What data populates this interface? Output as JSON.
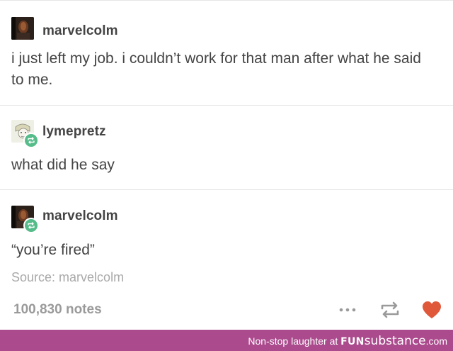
{
  "posts": [
    {
      "username": "marvelcolm",
      "text": "i just left my job. i couldn’t work for that man after what he said to me.",
      "avatar_icon": "dark-portrait-avatar",
      "reblog": false
    },
    {
      "username": "lymepretz",
      "text": "what did he say",
      "avatar_icon": "sketch-portrait-avatar",
      "reblog": true
    },
    {
      "username": "marvelcolm",
      "text": "“you’re fired”",
      "avatar_icon": "dark-portrait-avatar",
      "reblog": true
    }
  ],
  "source": {
    "label": "Source: ",
    "name": "marvelcolm"
  },
  "footer_bar": {
    "notes": "100,830 notes",
    "more_icon": "more-dots-icon",
    "reblog_icon": "reblog-icon",
    "like_icon": "heart-icon"
  },
  "watermark": {
    "text": "Non-stop laughter at ",
    "brand_part1": "FUN",
    "brand_part2": "substance",
    "brand_part3": ".com"
  },
  "colors": {
    "text": "#444444",
    "muted": "#a9a9a9",
    "reblog_badge": "#56bc8a",
    "heart": "#e0583a",
    "watermark_bar": "#ab4a8d"
  }
}
